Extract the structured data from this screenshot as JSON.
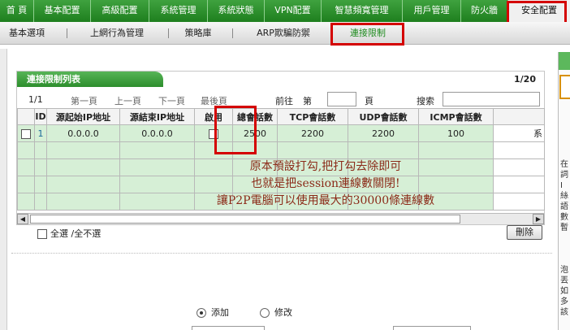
{
  "top_nav": {
    "items": [
      "首 頁",
      "基本配置",
      "高級配置",
      "系統管理",
      "系統狀態",
      "VPN配置",
      "智慧頻寬管理",
      "用戶管理",
      "防火牆",
      "安全配置"
    ]
  },
  "sub_nav": {
    "items": [
      "基本選項",
      "上網行為管理",
      "策略庫",
      "ARP欺騙防禦",
      "連接限制"
    ]
  },
  "list": {
    "title": "連接限制列表",
    "page_indicator": "1/20",
    "pager": {
      "current": "1/1",
      "first": "第一頁",
      "prev": "上一頁",
      "next": "下一頁",
      "last": "最後頁",
      "goto": "前往",
      "goto_prefix": "第",
      "goto_suffix": "頁",
      "search": "搜索"
    },
    "columns": [
      "",
      "ID",
      "源起始IP地址",
      "源結束IP地址",
      "啟用",
      "總會話數",
      "TCP會話數",
      "UDP會話數",
      "ICMP會話數",
      ""
    ],
    "row": {
      "id": "1",
      "start_ip": "0.0.0.0",
      "end_ip": "0.0.0.0",
      "total": "2500",
      "tcp": "2200",
      "udp": "2200",
      "icmp": "100",
      "extra": "系"
    }
  },
  "annotation": {
    "line1": "原本預設打勾,把打勾去除即可",
    "line2": "也就是把session連線數關閉!",
    "line3": "讓P2P電腦可以使用最大的30000條連線數"
  },
  "controls": {
    "select_all": "全選",
    "deselect_all": "/全不選",
    "delete": "刪除",
    "add": "添加",
    "modify": "修改"
  },
  "right_panel": {
    "chars": [
      "在",
      "詞",
      "I",
      "絲",
      "語",
      "數",
      "暫"
    ],
    "chars2": [
      "泡",
      "丟",
      "如",
      "多",
      "該"
    ]
  },
  "colors": {
    "nav_green": "#2a8f2a",
    "row_green": "#d6efd6",
    "annotation": "#8b2a18",
    "highlight_red": "#d40000"
  }
}
